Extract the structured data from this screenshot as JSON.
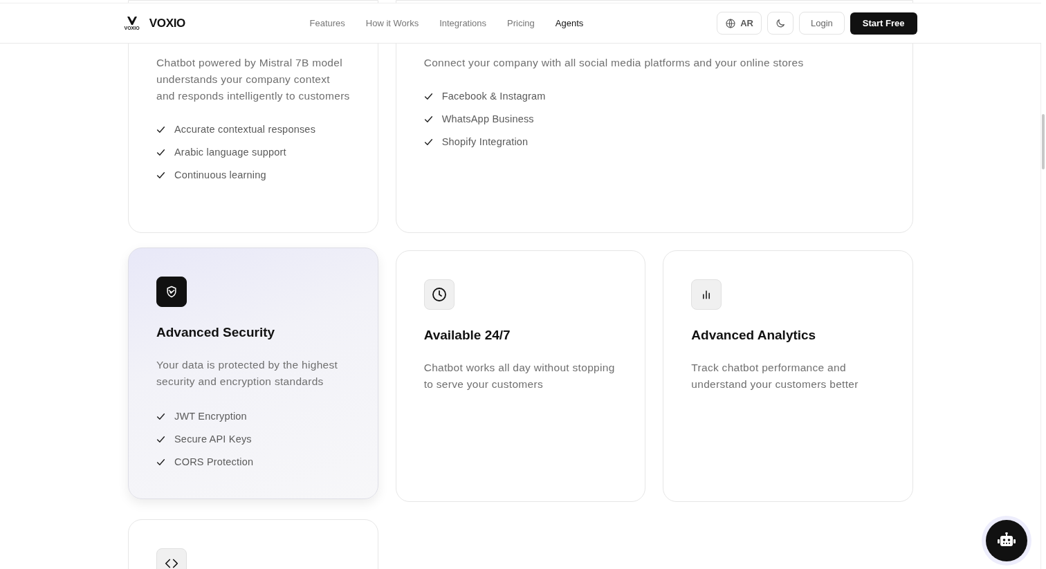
{
  "header": {
    "brand": "VOXIO",
    "logo_caption": "VOXIO",
    "nav": [
      {
        "label": "Features",
        "selected": false
      },
      {
        "label": "How it Works",
        "selected": false
      },
      {
        "label": "Integrations",
        "selected": false
      },
      {
        "label": "Pricing",
        "selected": false
      },
      {
        "label": "Agents",
        "selected": true
      }
    ],
    "language_button": "AR",
    "login_button": "Login",
    "cta_button": "Start Free"
  },
  "feature_rows": [
    [
      {
        "kind": "none",
        "highlighted": false,
        "description": "Chatbot powered by Mistral 7B model understands your company context and responds intelligently to customers",
        "points": [
          "Accurate contextual responses",
          "Arabic language support",
          "Continuous learning"
        ]
      },
      {
        "kind": "none",
        "highlighted": false,
        "description": "Connect your company with all social media platforms and your online stores",
        "points": [
          "Facebook & Instagram",
          "WhatsApp Business",
          "Shopify Integration"
        ]
      }
    ],
    [
      {
        "kind": "security",
        "highlighted": true,
        "title": "Advanced Security",
        "description": "Your data is protected by the highest security and encryption standards",
        "points": [
          "JWT Encryption",
          "Secure API Keys",
          "CORS Protection"
        ]
      },
      {
        "kind": "clock",
        "highlighted": false,
        "title": "Available 24/7",
        "description": "Chatbot works all day without stopping to serve your customers"
      },
      {
        "kind": "analytics",
        "highlighted": false,
        "title": "Advanced Analytics",
        "description": "Track chatbot performance and understand your customers better"
      }
    ],
    [
      {
        "kind": "code",
        "highlighted": false
      }
    ]
  ]
}
